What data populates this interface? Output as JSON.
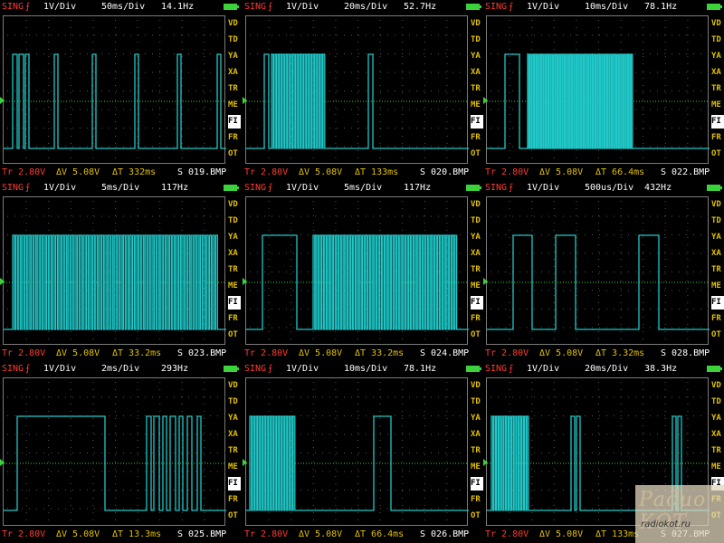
{
  "menu": [
    "VD",
    "TD",
    "YA",
    "XA",
    "TR",
    "ME",
    "FI",
    "FR",
    "OT"
  ],
  "menu_selected": "FI",
  "trace_color": "#20c8c8",
  "accent_red": "#ff3b30",
  "text_yellow": "#e0c000",
  "battery_color": "#3bd23b",
  "panels": [
    {
      "mode": "SING",
      "trig": "⨍",
      "vdiv": "1V/Div",
      "tdiv": "50ms/Div",
      "freq": "14.1Hz",
      "tr": "Tr 2.80V",
      "dv": "ΔV 5.08V",
      "dt": "ΔT 332ms",
      "file": "S 019.BMP"
    },
    {
      "mode": "SING",
      "trig": "⨍",
      "vdiv": "1V/Div",
      "tdiv": "20ms/Div",
      "freq": "52.7Hz",
      "tr": "Tr 2.80V",
      "dv": "ΔV 5.08V",
      "dt": "ΔT 133ms",
      "file": "S 020.BMP"
    },
    {
      "mode": "SING",
      "trig": "⨍",
      "vdiv": "1V/Div",
      "tdiv": "10ms/Div",
      "freq": "78.1Hz",
      "tr": "Tr 2.80V",
      "dv": "ΔV 5.08V",
      "dt": "ΔT 66.4ms",
      "file": "S 022.BMP"
    },
    {
      "mode": "SING",
      "trig": "⨍",
      "vdiv": "1V/Div",
      "tdiv": "5ms/Div",
      "freq": "117Hz",
      "tr": "Tr 2.80V",
      "dv": "ΔV 5.08V",
      "dt": "ΔT 33.2ms",
      "file": "S 023.BMP"
    },
    {
      "mode": "SING",
      "trig": "⨍",
      "vdiv": "1V/Div",
      "tdiv": "5ms/Div",
      "freq": "117Hz",
      "tr": "Tr 2.80V",
      "dv": "ΔV 5.08V",
      "dt": "ΔT 33.2ms",
      "file": "S 024.BMP"
    },
    {
      "mode": "SING",
      "trig": "⨍",
      "vdiv": "1V/Div",
      "tdiv": "500us/Div",
      "freq": "432Hz",
      "tr": "Tr 2.80V",
      "dv": "ΔV 5.08V",
      "dt": "ΔT 3.32ms",
      "file": "S 028.BMP"
    },
    {
      "mode": "SING",
      "trig": "⨍",
      "vdiv": "1V/Div",
      "tdiv": "2ms/Div",
      "freq": "293Hz",
      "tr": "Tr 2.80V",
      "dv": "ΔV 5.08V",
      "dt": "ΔT 13.3ms",
      "file": "S 025.BMP"
    },
    {
      "mode": "SING",
      "trig": "⨍",
      "vdiv": "1V/Div",
      "tdiv": "10ms/Div",
      "freq": "78.1Hz",
      "tr": "Tr 2.80V",
      "dv": "ΔV 5.08V",
      "dt": "ΔT 66.4ms",
      "file": "S 026.BMP"
    },
    {
      "mode": "SING",
      "trig": "⨍",
      "vdiv": "1V/Div",
      "tdiv": "20ms/Div",
      "freq": "38.3Hz",
      "tr": "Tr 2.80V",
      "dv": "ΔV 5.08V",
      "dt": "ΔT 133ms",
      "file": "S 027.BMP"
    }
  ],
  "watermark": {
    "logo": "Радио КОТ",
    "url": "radiokot.ru"
  }
}
